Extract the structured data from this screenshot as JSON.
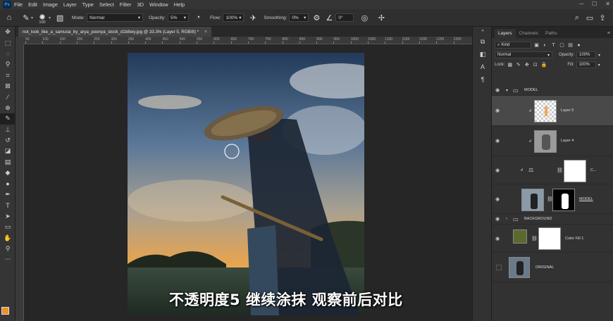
{
  "menubar": {
    "logo": "Ps",
    "items": [
      "File",
      "Edit",
      "Image",
      "Layer",
      "Type",
      "Select",
      "Filter",
      "3D",
      "Window",
      "Help"
    ]
  },
  "options": {
    "brush_size": "100",
    "mode_label": "Mode:",
    "mode_value": "Normal",
    "opacity_label": "Opacity:",
    "opacity_value": "5%",
    "flow_label": "Flow:",
    "flow_value": "100%",
    "smoothing_label": "Smoothing:",
    "smoothing_value": "0%",
    "angle_value": "0°"
  },
  "document": {
    "tab_title": "not_look_like_a_samurai_by_arya_poenya_stock_d1b8eiy.jpg @ 33.3% (Layer 5, RGB/8) *",
    "close": "×",
    "ruler_labels": [
      "50",
      "100",
      "150",
      "200",
      "250",
      "300",
      "350",
      "400",
      "450",
      "500",
      "550",
      "600",
      "650",
      "700",
      "750",
      "800",
      "850",
      "900",
      "950",
      "1000",
      "1050",
      "1100",
      "1150",
      "1200",
      "1250",
      "1300"
    ]
  },
  "subtitle": "不透明度5 继续涂抹 观察前后对比",
  "colors": {
    "foreground": "#f0902a",
    "background": "#ffffff",
    "accent": "#33a4ff"
  },
  "layers_panel": {
    "tabs": [
      "Layers",
      "Channels",
      "Paths"
    ],
    "filter_kind": "Kind",
    "blend_mode": "Normal",
    "opacity_label": "Opacity:",
    "opacity_value": "100%",
    "lock_label": "Lock:",
    "fill_label": "Fill:",
    "fill_value": "100%",
    "layers": [
      {
        "name": "MODEL",
        "kind": "group"
      },
      {
        "name": "Layer 5",
        "kind": "pixel"
      },
      {
        "name": "Layer 4",
        "kind": "pixel"
      },
      {
        "name": "C...",
        "kind": "adjustment"
      },
      {
        "name": "MODEL",
        "kind": "masked"
      },
      {
        "name": "BACKGROUND",
        "kind": "group"
      },
      {
        "name": "Color Fill 1",
        "kind": "fill"
      },
      {
        "name": "ORIGINAL",
        "kind": "pixel"
      }
    ]
  }
}
